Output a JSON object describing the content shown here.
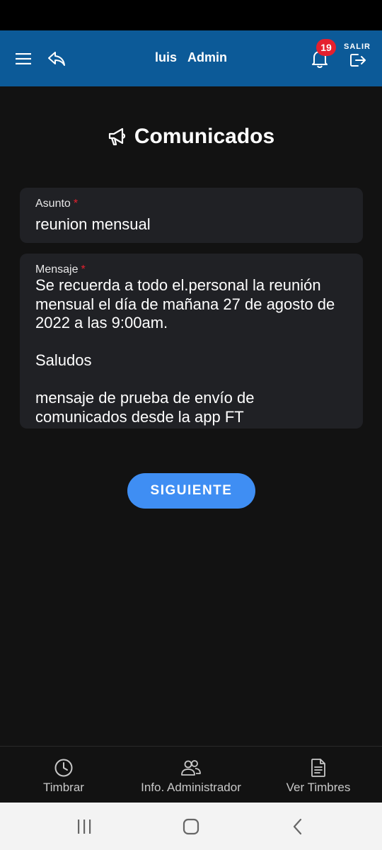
{
  "app_bar": {
    "user_name": "luis",
    "user_role": "Admin",
    "notification_count": "19",
    "exit_label": "SALIR"
  },
  "page": {
    "title": "Comunicados"
  },
  "form": {
    "asunto": {
      "label": "Asunto",
      "required_mark": "*",
      "value": "reunion mensual"
    },
    "mensaje": {
      "label": "Mensaje",
      "required_mark": "*",
      "value": "Se recuerda a todo el.personal la reunión mensual el día de mañana 27 de agosto de 2022 a las 9:00am.\n\nSaludos\n\nmensaje de prueba de envío de comunicados desde la app FT"
    },
    "next_label": "SIGUIENTE"
  },
  "bottom_nav": {
    "items": [
      {
        "label": "Timbrar",
        "icon": "clock-icon"
      },
      {
        "label": "Info. Administrador",
        "icon": "users-icon"
      },
      {
        "label": "Ver Timbres",
        "icon": "document-icon"
      }
    ]
  },
  "colors": {
    "app_bar": "#0c5a98",
    "background": "#121212",
    "field_bg": "#202125",
    "accent_button": "#3f8ef3",
    "badge": "#e5202e"
  }
}
